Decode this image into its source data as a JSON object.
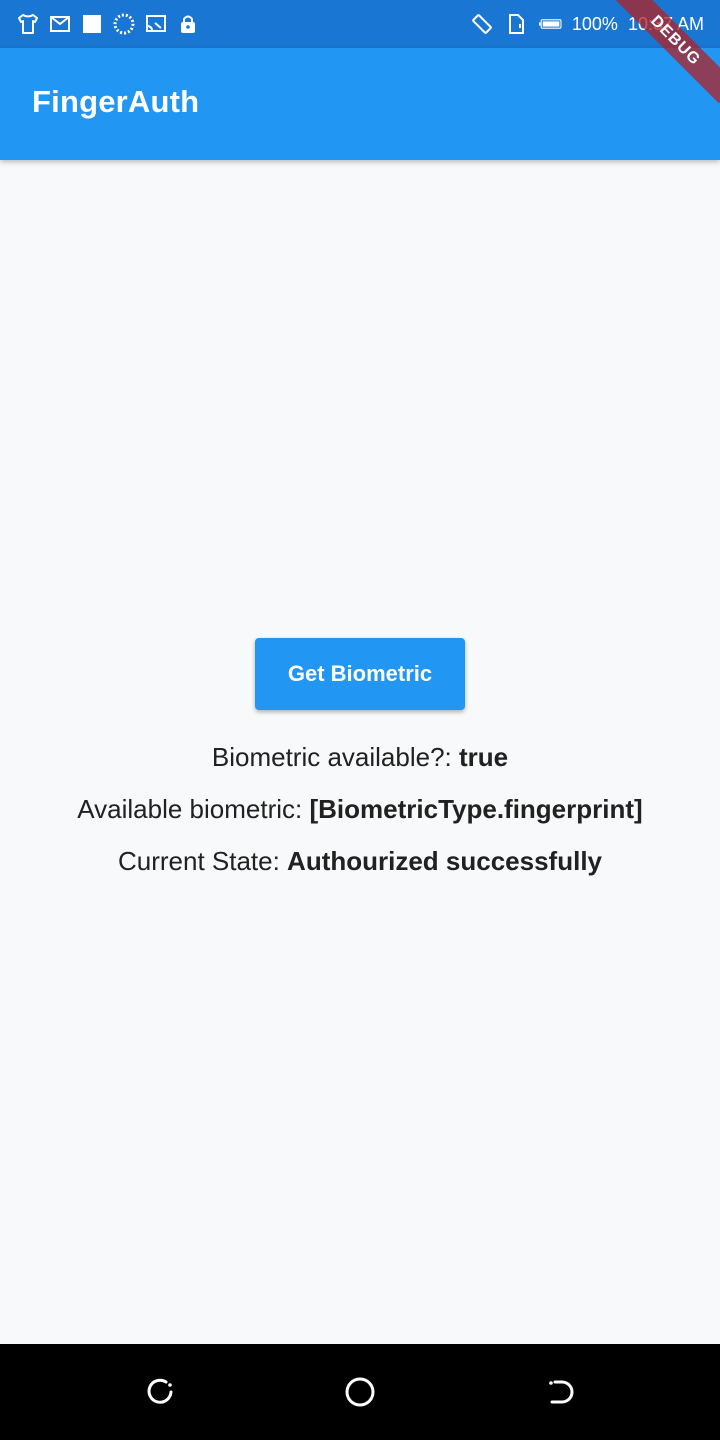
{
  "status_bar": {
    "left_icons": [
      "tshirt-icon",
      "gmail-icon",
      "square-icon",
      "sync-icon",
      "cast-icon",
      "lock-icon"
    ],
    "right_icons": [
      "rotate-icon",
      "no-sim-icon",
      "battery-icon"
    ],
    "battery": "100%",
    "time": "10:37 AM"
  },
  "app_bar": {
    "title": "FingerAuth"
  },
  "debug_banner": {
    "label": "DEBUG"
  },
  "main": {
    "button_label": "Get Biometric",
    "lines": [
      {
        "label": "Biometric available?: ",
        "value": "true"
      },
      {
        "label": "Available biometric: ",
        "value": "[BiometricType.fingerprint]"
      },
      {
        "label": "Current State: ",
        "value": "Authourized successfully"
      }
    ]
  },
  "nav_bar": {
    "buttons": [
      "recent-apps-icon",
      "home-icon",
      "back-icon"
    ]
  },
  "colors": {
    "status_bar": "#1976d2",
    "app_bar": "#2196f3",
    "button": "#2196f3",
    "background": "#f8f9fa",
    "nav_bar": "#000000"
  }
}
